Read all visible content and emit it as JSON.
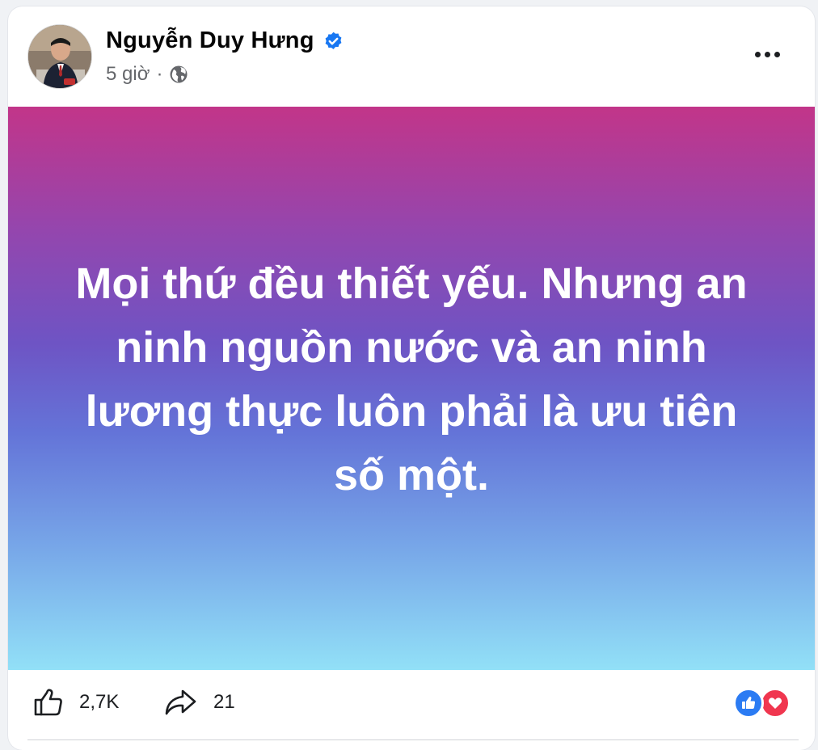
{
  "post": {
    "author": {
      "name": "Nguyễn Duy Hưng",
      "verified": true
    },
    "time": "5 giờ",
    "separator": "·",
    "audience_icon": "globe-icon",
    "text": "Mọi thứ đều thiết yếu. Nhưng an ninh nguồn nước và an ninh lương thực luôn phải là ưu tiên số một.",
    "background_gradient": [
      "#c23589",
      "#6e54c4",
      "#92e0f7"
    ]
  },
  "actions": {
    "like_count": "2,7K",
    "share_count": "21"
  },
  "reactions": [
    {
      "name": "like-reaction-icon",
      "color": "#2b7bf3"
    },
    {
      "name": "love-reaction-icon",
      "color": "#f0364f"
    }
  ]
}
